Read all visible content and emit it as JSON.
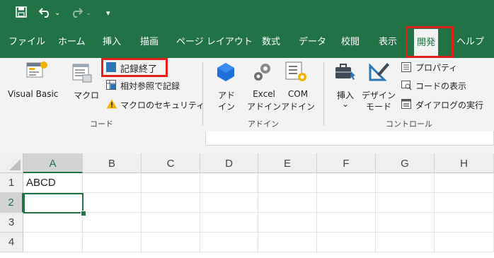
{
  "quick_access": {
    "save_icon": "save-icon",
    "undo_icon": "undo-icon",
    "redo_icon": "redo-icon",
    "customize_icon": "customize-qat-icon"
  },
  "tabs": [
    {
      "label": "ファイル"
    },
    {
      "label": "ホーム"
    },
    {
      "label": "挿入"
    },
    {
      "label": "描画"
    },
    {
      "label": "ページ レイアウト"
    },
    {
      "label": "数式"
    },
    {
      "label": "データ"
    },
    {
      "label": "校閲"
    },
    {
      "label": "表示"
    },
    {
      "label": "開発",
      "active": true
    },
    {
      "label": "ヘルプ"
    }
  ],
  "ribbon": {
    "code": {
      "visual_basic": "Visual Basic",
      "macro": "マクロ",
      "stop_recording": "記録終了",
      "relative_ref": "相対参照で記録",
      "macro_security": "マクロのセキュリティ",
      "group_label": "コード"
    },
    "addins": {
      "addins_line1": "アド",
      "addins_line2": "イン",
      "excel_line1": "Excel",
      "excel_line2": "アドイン",
      "com_line1": "COM",
      "com_line2": "アドイン",
      "group_label": "アドイン"
    },
    "controls": {
      "insert": "挿入",
      "insert_arrow": "⌄",
      "design_line1": "デザイン",
      "design_line2": "モード",
      "properties": "プロパティ",
      "view_code": "コードの表示",
      "run_dialog": "ダイアログの実行",
      "group_label": "コントロール"
    }
  },
  "colors": {
    "brand_green": "#217346",
    "highlight_red": "#e0201b"
  },
  "sheet": {
    "columns": [
      "A",
      "B",
      "C",
      "D",
      "E",
      "F",
      "G",
      "H"
    ],
    "rows": [
      "1",
      "2",
      "3",
      "4"
    ],
    "cells": {
      "A1": "ABCD"
    },
    "selected_cell": "A2"
  }
}
